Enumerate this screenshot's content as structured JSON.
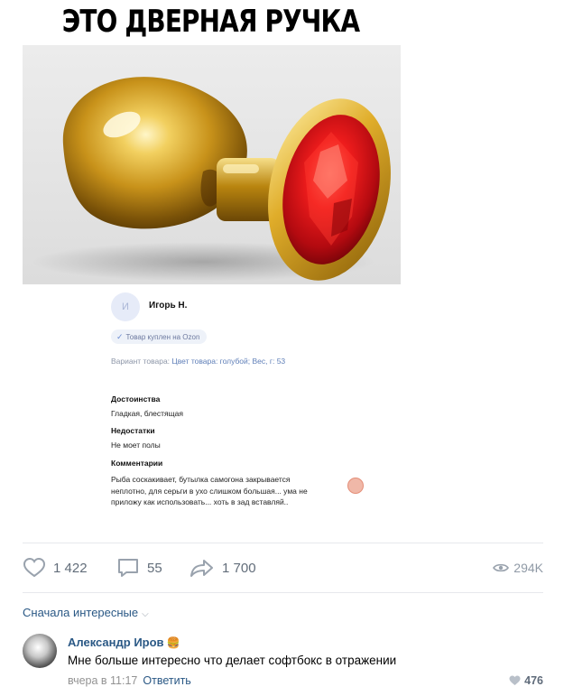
{
  "meme_title": "ЭТО ДВЕРНАЯ РУЧКА",
  "review": {
    "avatar_letter": "И",
    "author": "Игорь Н.",
    "badge": "Товар куплен на Ozon",
    "variant_label": "Вариант товара:",
    "variant_value": "Цвет товара: голубой; Вес, г: 53",
    "pros_title": "Достоинства",
    "pros_text": "Гладкая, блестящая",
    "cons_title": "Недостатки",
    "cons_text": "Не моет полы",
    "comments_title": "Комментарии",
    "comments_text": "Рыба соскакивает, бутылка самогона закрывается неплотно, для серьги в ухо слишком большая... ума не приложу как использовать... хоть в зад вставляй.."
  },
  "actions": {
    "likes": "1 422",
    "comments": "55",
    "shares": "1 700",
    "views": "294K"
  },
  "sort_label": "Сначала интересные",
  "comment": {
    "author": "Александр Иров",
    "author_emoji": "🍔",
    "text": "Мне больше интересно что делает софтбокс в отражении",
    "time": "вчера в 11:17",
    "reply_label": "Ответить",
    "likes": "476"
  },
  "colors": {
    "link": "#2a5885",
    "muted": "#939393",
    "icon": "#99a2ad",
    "gem_red": "#e8141c",
    "gold": "#d4a21c"
  }
}
